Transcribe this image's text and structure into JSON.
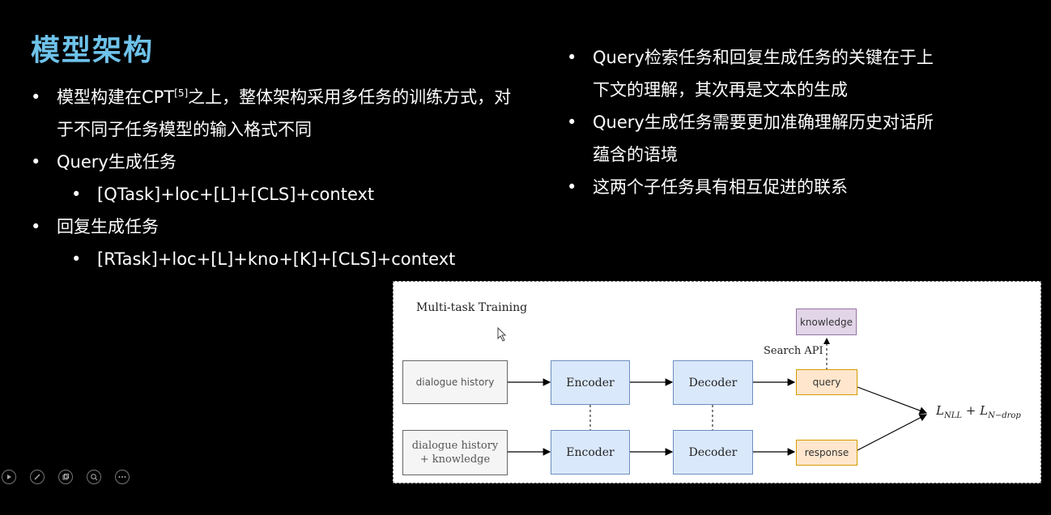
{
  "title": "模型架构",
  "left_bullets": {
    "b1_pre": "模型构建在CPT",
    "b1_sup": "[5]",
    "b1_post": "之上，整体架构采用多任务的训练方式，对",
    "b1_line2": "于不同子任务模型的输入格式不同",
    "b2": "Query生成任务",
    "b2_sub": "[QTask]+loc+[L]+[CLS]+context",
    "b3": "回复生成任务",
    "b3_sub": "[RTask]+loc+[L]+kno+[K]+[CLS]+context"
  },
  "right_bullets": {
    "r1_line1": "Query检索任务和回复生成任务的关键在于上",
    "r1_line2": "下文的理解，其次再是文本的生成",
    "r2_line1": "Query生成任务需要更加准确理解历史对话所",
    "r2_line2": "蕴含的语境",
    "r3": "这两个子任务具有相互促进的联系"
  },
  "bullet_char": "•",
  "diagram": {
    "title": "Multi-task Training",
    "input_top": "dialogue history",
    "input_bottom_1": "dialogue history",
    "input_bottom_2": "+ knowledge",
    "encoder": "Encoder",
    "decoder": "Decoder",
    "query": "query",
    "response": "response",
    "knowledge": "knowledge",
    "search_api": "Search API",
    "loss_a": "L",
    "loss_a_sub": "NLL",
    "loss_plus": " + ",
    "loss_b": "L",
    "loss_b_sub": "N−drop"
  },
  "colors": {
    "title": "#6ec2ea",
    "encoder_fill": "#dae8fc",
    "output_fill": "#ffe6cc",
    "knowledge_fill": "#e1d5e7"
  },
  "toolbar_icons": [
    "play-icon",
    "pen-icon",
    "copy-icon",
    "zoom-icon",
    "more-icon"
  ]
}
